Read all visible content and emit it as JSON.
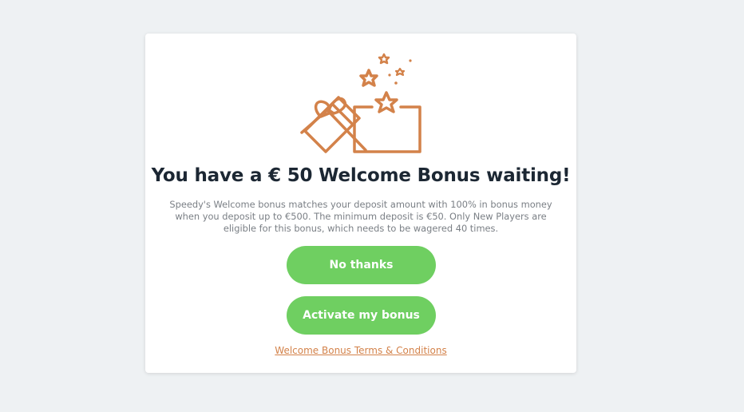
{
  "modal": {
    "title": "You have a € 50 Welcome Bonus waiting!",
    "description": "Speedy's Welcome bonus matches your deposit amount with 100% in bonus money when you deposit up to €500. The minimum deposit is €50. Only New Players are eligible for this bonus, which needs to be wagered 40 times.",
    "no_thanks_label": "No thanks",
    "activate_label": "Activate my bonus",
    "terms_link": "Welcome Bonus Terms & Conditions",
    "icon": "gift-box-icon"
  },
  "colors": {
    "accent_green": "#6fcf61",
    "gift_orange": "#d3824a",
    "title_dark": "#1c2733",
    "background": "#eef1f3"
  }
}
